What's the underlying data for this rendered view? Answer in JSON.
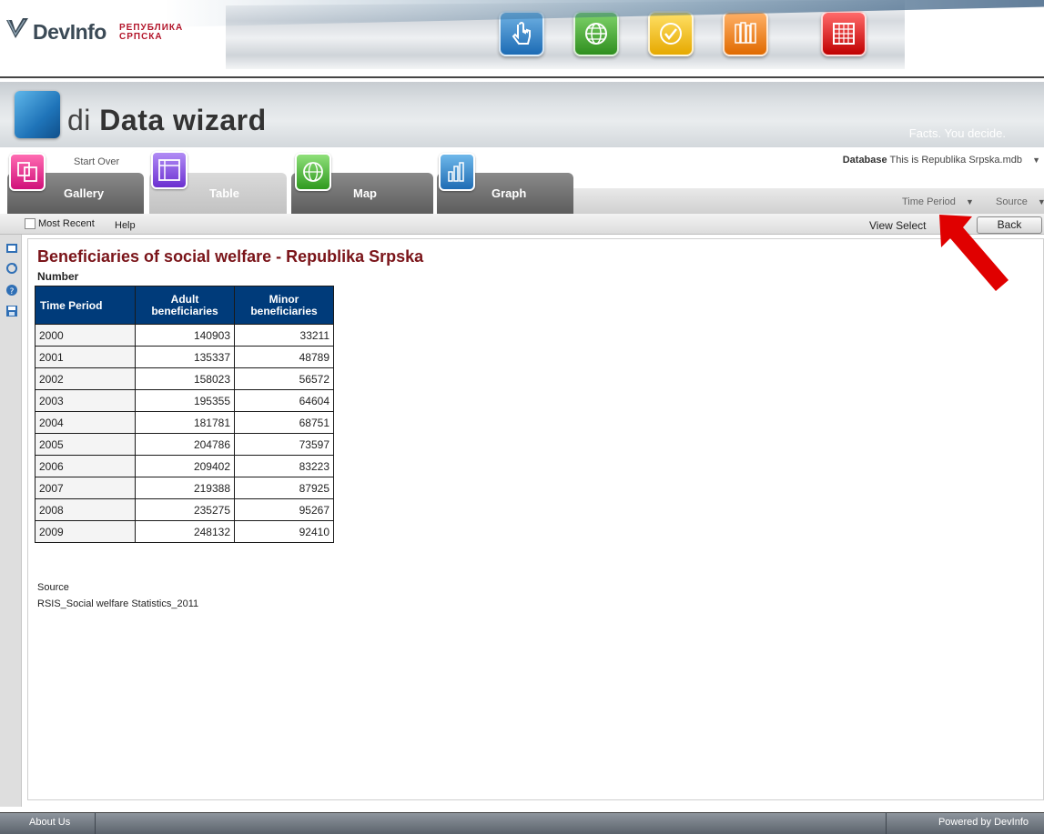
{
  "banner": {
    "logo_text": "DevInfo",
    "logo_subtitle_line1": "РЕПУБЛИКА",
    "logo_subtitle_line2": "СРПСКА",
    "icons": [
      "touch-icon",
      "globe-icon",
      "check-icon",
      "books-icon",
      "calendar-icon"
    ]
  },
  "app": {
    "title_prefix": "di",
    "title_main": "Data wizard",
    "tagline": "Facts. You decide."
  },
  "tabs": {
    "start_over": "Start Over",
    "items": [
      {
        "label": "Gallery",
        "icon": "gallery-icon",
        "active": false
      },
      {
        "label": "Table",
        "icon": "table-icon",
        "active": true
      },
      {
        "label": "Map",
        "icon": "globe-icon",
        "active": false
      },
      {
        "label": "Graph",
        "icon": "bar-chart-icon",
        "active": false
      }
    ]
  },
  "database": {
    "label": "Database",
    "value": "This is Republika Srpska.mdb"
  },
  "filters": {
    "time_period": "Time Period",
    "source": "Source"
  },
  "toolbar": {
    "most_recent": "Most Recent",
    "help": "Help",
    "view_selections": "View Select",
    "back": "Back"
  },
  "report": {
    "title": "Beneficiaries of social welfare - Republika Srpska",
    "unit": "Number",
    "columns": [
      "Time Period",
      "Adult beneficiaries",
      "Minor beneficiaries"
    ],
    "rows": [
      [
        "2000",
        "140903",
        "33211"
      ],
      [
        "2001",
        "135337",
        "48789"
      ],
      [
        "2002",
        "158023",
        "56572"
      ],
      [
        "2003",
        "195355",
        "64604"
      ],
      [
        "2004",
        "181781",
        "68751"
      ],
      [
        "2005",
        "204786",
        "73597"
      ],
      [
        "2006",
        "209402",
        "83223"
      ],
      [
        "2007",
        "219388",
        "87925"
      ],
      [
        "2008",
        "235275",
        "95267"
      ],
      [
        "2009",
        "248132",
        "92410"
      ]
    ],
    "source_label": "Source",
    "source_value": "RSIS_Social welfare Statistics_2011"
  },
  "footer": {
    "about_us": "About Us",
    "powered_by": "Powered by DevInfo"
  },
  "colors": {
    "title_red": "#7a1419",
    "header_blue": "#003b7a",
    "arrow_red": "#e00000"
  }
}
